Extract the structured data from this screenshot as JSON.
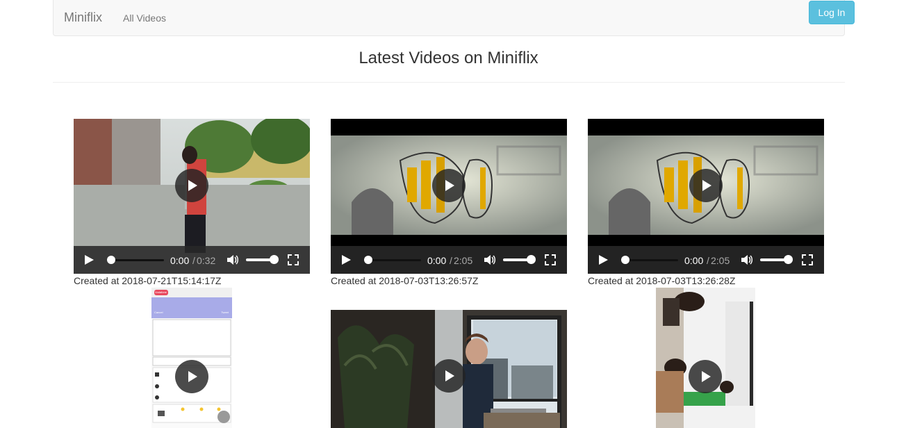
{
  "nav": {
    "brand": "Miniflix",
    "all_videos": "All Videos",
    "login": "Log In"
  },
  "page_title": "Latest Videos on Miniflix",
  "videos": [
    {
      "current_time": "0:00",
      "separator": "/",
      "duration": "0:32",
      "created": "Created at 2018-07-21T15:14:17Z"
    },
    {
      "current_time": "0:00",
      "separator": "/",
      "duration": "2:05",
      "created": "Created at 2018-07-03T13:26:57Z"
    },
    {
      "current_time": "0:00",
      "separator": "/",
      "duration": "2:05",
      "created": "Created at 2018-07-03T13:26:28Z"
    }
  ],
  "phone_screen": {
    "status": "Vodafone",
    "header_left": "Cancel",
    "header_right": "Tweet"
  },
  "colors": {
    "accent": "#5bc0de",
    "nav_bg": "#f8f8f8",
    "player_bar": "#2a2a2a"
  }
}
